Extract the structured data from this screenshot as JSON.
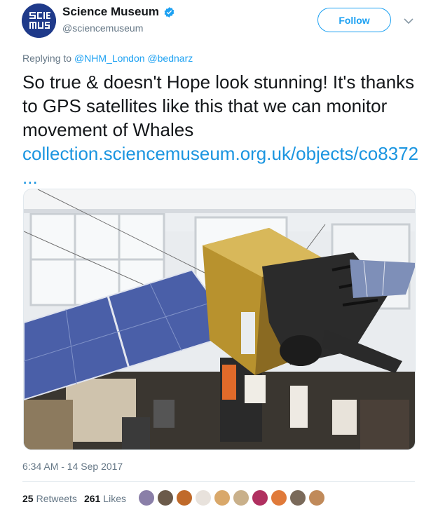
{
  "header": {
    "display_name": "Science Museum",
    "handle": "@sciencemuseum",
    "follow_label": "Follow",
    "avatar_text": "SCIENCE MUSEUM",
    "brand_color": "#1f3a8a",
    "verified_icon": "verified-badge-icon"
  },
  "reply": {
    "prefix": "Replying to",
    "mentions": [
      "@NHM_London",
      "@bednarz"
    ]
  },
  "tweet": {
    "text": "So true & doesn't Hope look stunning! It's thanks to GPS satellites like this that we can monitor movement of Whales",
    "link": "collection.sciencemuseum.org.uk/objects/co8372  ...",
    "link_color": "#1b95e0"
  },
  "media": {
    "description_icon": "satellite-exhibit-photo"
  },
  "meta": {
    "timestamp": "6:34 AM - 14 Sep 2017"
  },
  "stats": {
    "retweets_count": "25",
    "retweets_label": "Retweets",
    "likes_count": "261",
    "likes_label": "Likes",
    "liker_colors": [
      "#8a7fa8",
      "#6b5a4a",
      "#c06a2a",
      "#e8e2dc",
      "#d9a86a",
      "#c9b08a",
      "#b03060",
      "#e07a3a",
      "#7a6a5a",
      "#c08a5a"
    ]
  },
  "colors": {
    "accent": "#1da1f2",
    "muted": "#657786",
    "text": "#14171a"
  }
}
